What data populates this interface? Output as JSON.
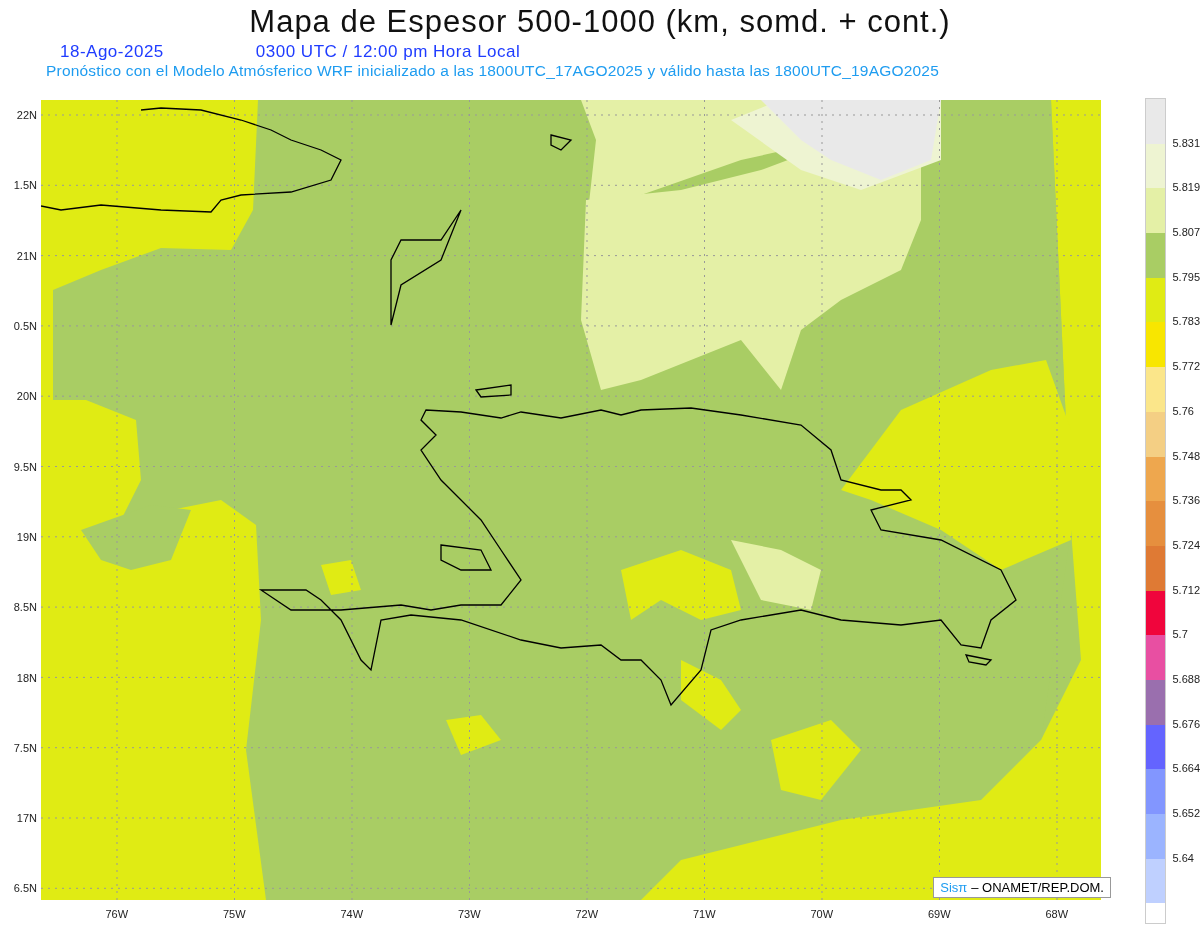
{
  "title": "Mapa de Espesor 500-1000 (km, somd. + cont.)",
  "date": "18-Ago-2025",
  "time": "0300 UTC / 12:00 pm Hora Local",
  "subtitle": "Pronóstico con el Modelo Atmósferico WRF inicializado a las 1800UTC_17AGO2025 y válido hasta las  1800UTC_19AGO2025",
  "y_labels": [
    "22N",
    "1.5N",
    "21N",
    "0.5N",
    "20N",
    "9.5N",
    "19N",
    "8.5N",
    "18N",
    "7.5N",
    "17N",
    "6.5N"
  ],
  "x_labels": [
    "76W",
    "75W",
    "74W",
    "73W",
    "72W",
    "71W",
    "70W",
    "69W",
    "68W"
  ],
  "credit": {
    "brand": "Sisπ",
    "text": "– ONAMET/REP.DOM."
  },
  "colorbar": [
    {
      "color": "#e9e9e9",
      "label": "5.831"
    },
    {
      "color": "#eef4d2",
      "label": "5.819"
    },
    {
      "color": "#e4f0a6",
      "label": "5.807"
    },
    {
      "color": "#a9cd64",
      "label": "5.795"
    },
    {
      "color": "#e0eb14",
      "label": "5.783"
    },
    {
      "color": "#f8e600",
      "label": "5.772"
    },
    {
      "color": "#fbe68a",
      "label": "5.76"
    },
    {
      "color": "#f4cf84",
      "label": "5.748"
    },
    {
      "color": "#eea74e",
      "label": "5.736"
    },
    {
      "color": "#e68f3e",
      "label": "5.724"
    },
    {
      "color": "#df7a34",
      "label": "5.712"
    },
    {
      "color": "#f0053c",
      "label": "5.7"
    },
    {
      "color": "#e84fa2",
      "label": "5.688"
    },
    {
      "color": "#9a6fae",
      "label": "5.676"
    },
    {
      "color": "#6464ff",
      "label": "5.664"
    },
    {
      "color": "#8296ff",
      "label": "5.652"
    },
    {
      "color": "#9bb4ff",
      "label": "5.64"
    },
    {
      "color": "#bfd0ff"
    }
  ]
}
